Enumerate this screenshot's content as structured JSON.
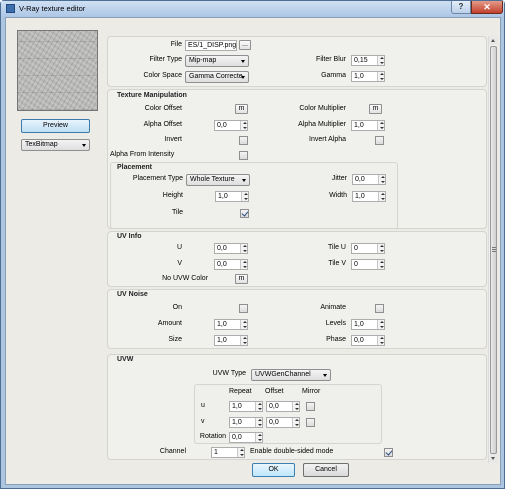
{
  "window": {
    "title": "V-Ray texture editor",
    "help_label": "?",
    "close_label": "✕"
  },
  "left": {
    "preview_label": "Preview",
    "type_value": "TexBitmap"
  },
  "file": {
    "label": "File",
    "value": "ES/1_DISP.png",
    "browse_label": "...",
    "filter_type_label": "Filter Type",
    "filter_type_value": "Mip-map",
    "filter_blur_label": "Filter Blur",
    "filter_blur_value": "0,15",
    "color_space_label": "Color Space",
    "color_space_value": "Gamma Correcte",
    "gamma_label": "Gamma",
    "gamma_value": "1,0"
  },
  "texman": {
    "header": "Texture Manipulation",
    "color_offset_label": "Color Offset",
    "color_multiplier_label": "Color Multiplier",
    "alpha_offset_label": "Alpha Offset",
    "alpha_offset_value": "0,0",
    "alpha_multiplier_label": "Alpha Multiplier",
    "alpha_multiplier_value": "1,0",
    "invert_label": "Invert",
    "invert_alpha_label": "Invert Alpha",
    "alpha_from_intensity_label": "Alpha From Intensity",
    "map_button_label": "m"
  },
  "placement": {
    "header": "Placement",
    "type_label": "Placement Type",
    "type_value": "Whole Texture",
    "jitter_label": "Jitter",
    "jitter_value": "0,0",
    "height_label": "Height",
    "height_value": "1,0",
    "width_label": "Width",
    "width_value": "1,0",
    "tile_label": "Tile",
    "tile_checked": true
  },
  "uvinfo": {
    "header": "UV Info",
    "u_label": "U",
    "u_value": "0,0",
    "tile_u_label": "Tile U",
    "tile_u_value": "0",
    "v_label": "V",
    "v_value": "0,0",
    "tile_v_label": "Tile V",
    "tile_v_value": "0",
    "no_uvw_color_label": "No UVW Color",
    "map_button_label": "m"
  },
  "uvnoise": {
    "header": "UV Noise",
    "on_label": "On",
    "animate_label": "Animate",
    "amount_label": "Amount",
    "amount_value": "1,0",
    "levels_label": "Levels",
    "levels_value": "1,0",
    "size_label": "Size",
    "size_value": "1,0",
    "phase_label": "Phase",
    "phase_value": "0,0"
  },
  "uvw": {
    "header": "UVW",
    "type_label": "UVW Type",
    "type_value": "UVWGenChannel",
    "repeat_label": "Repeat",
    "offset_label": "Offset",
    "mirror_label": "Mirror",
    "u_label": "u",
    "u_repeat": "1,0",
    "u_offset": "0,0",
    "v_label": "v",
    "v_repeat": "1,0",
    "v_offset": "0,0",
    "rotation_label": "Rotation",
    "rotation_value": "0,0",
    "channel_label": "Channel",
    "channel_value": "1",
    "double_sided_label": "Enable double-sided mode",
    "double_sided_checked": true
  },
  "buttons": {
    "ok_label": "OK",
    "cancel_label": "Cancel"
  }
}
